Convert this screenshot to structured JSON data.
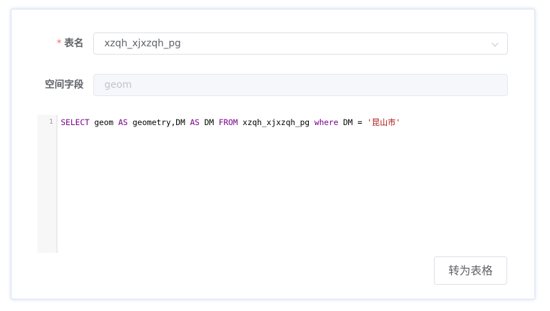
{
  "form": {
    "table_name": {
      "required_mark": "*",
      "label": "表名",
      "value": "xzqh_xjxzqh_pg",
      "icon": "chevron-down-icon"
    },
    "spatial_field": {
      "label": "空间字段",
      "value": "geom",
      "disabled": true
    }
  },
  "editor": {
    "lines": [
      {
        "number": "1",
        "tokens": [
          {
            "text": "SELECT",
            "type": "keyword"
          },
          {
            "text": " geom ",
            "type": "plain"
          },
          {
            "text": "AS",
            "type": "keyword"
          },
          {
            "text": " geometry,DM ",
            "type": "plain"
          },
          {
            "text": "AS",
            "type": "keyword"
          },
          {
            "text": " DM ",
            "type": "plain"
          },
          {
            "text": "FROM",
            "type": "keyword"
          },
          {
            "text": " xzqh_xjxzqh_pg ",
            "type": "plain"
          },
          {
            "text": "where",
            "type": "keyword"
          },
          {
            "text": " DM = ",
            "type": "plain"
          },
          {
            "text": "'昆山市'",
            "type": "string"
          }
        ]
      }
    ]
  },
  "actions": {
    "convert_label": "转为表格"
  },
  "colors": {
    "keyword": "#770088",
    "string": "#aa1111",
    "required": "#f56c6c",
    "frame_border": "#e6ebf6"
  }
}
